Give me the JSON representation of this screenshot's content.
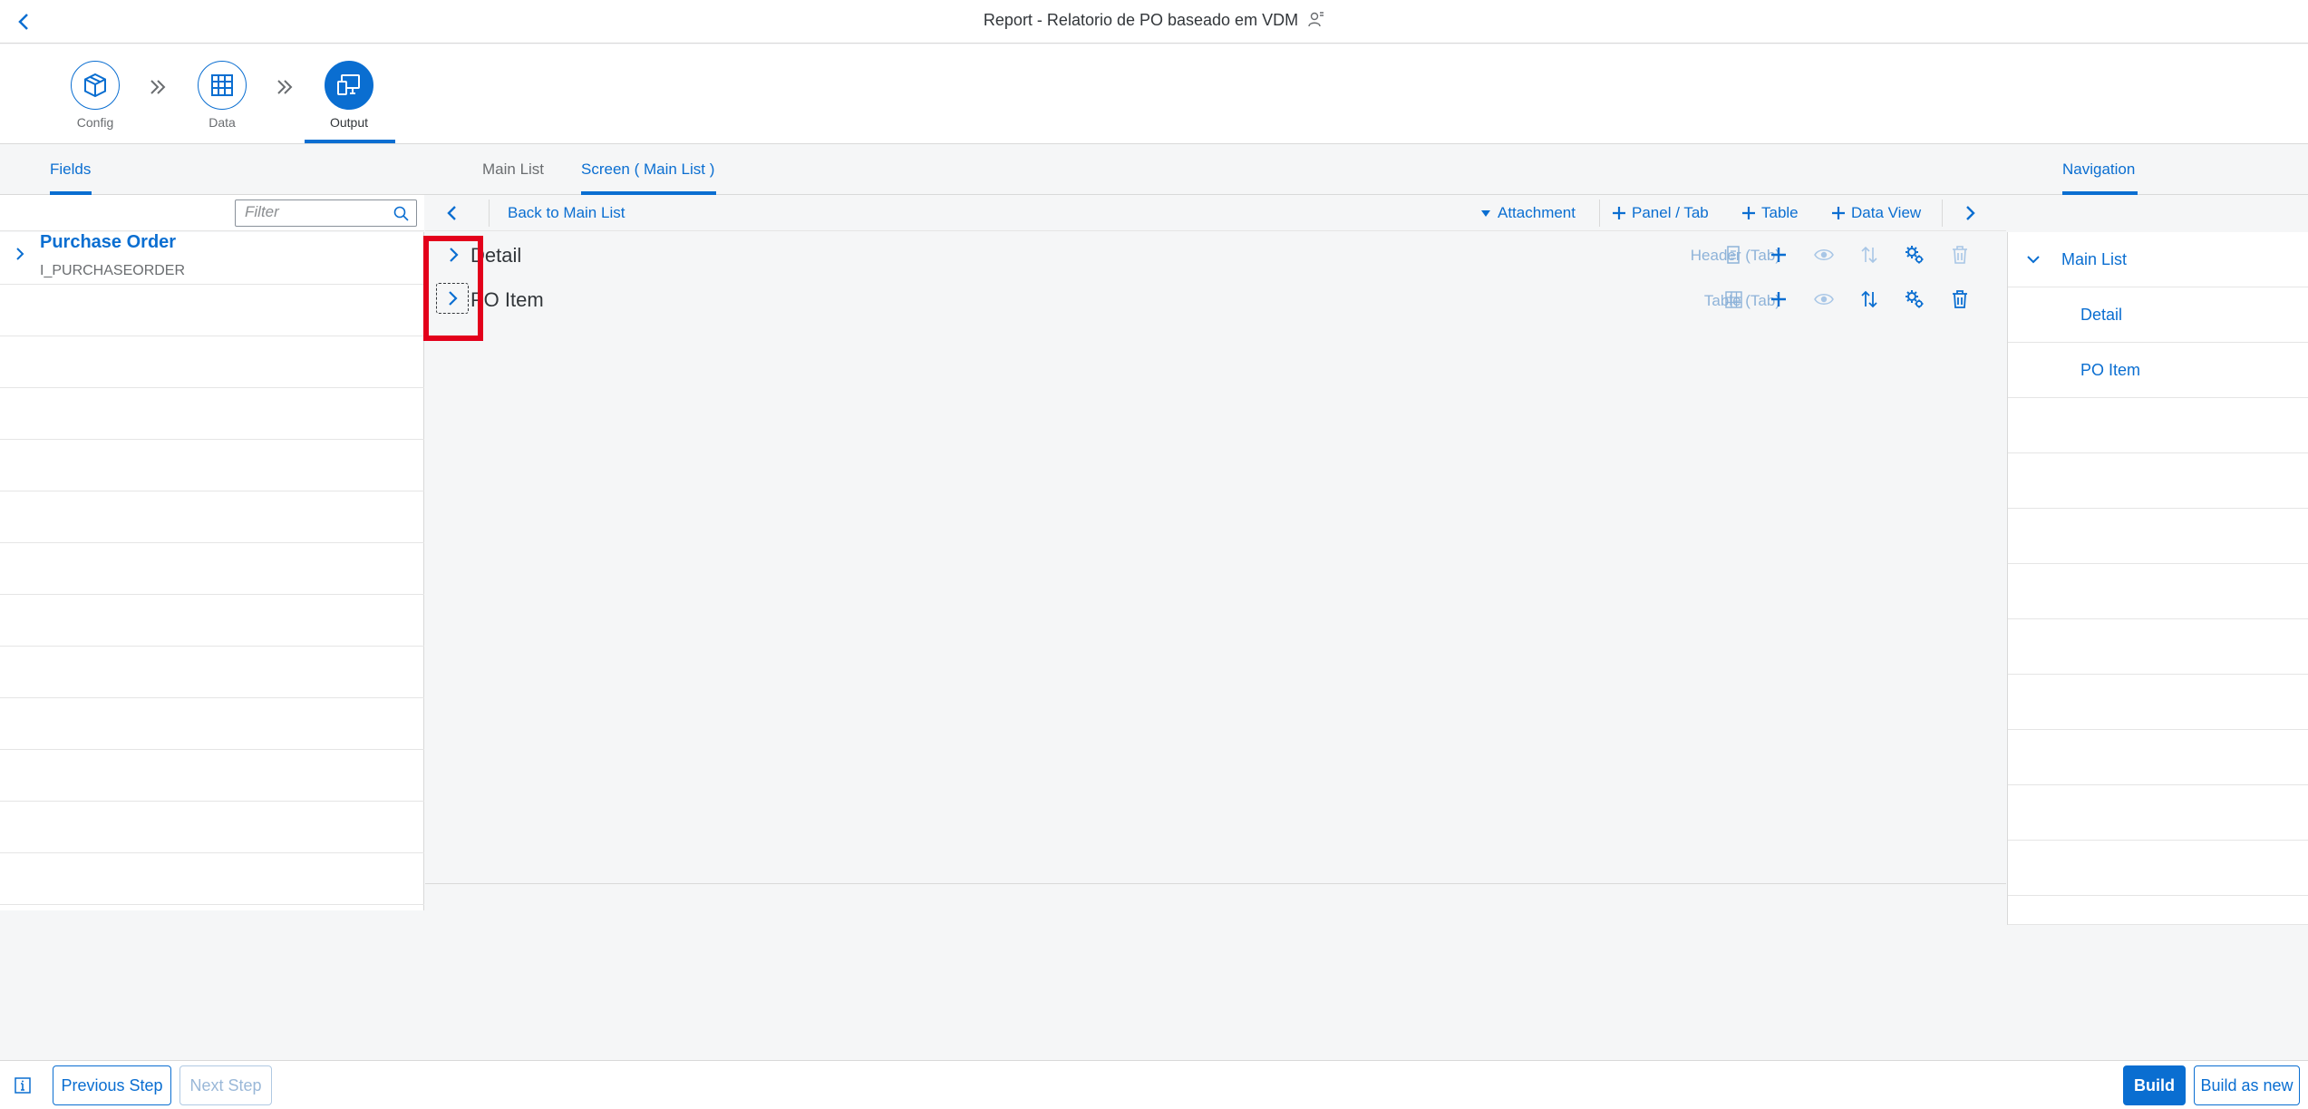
{
  "shell": {
    "title": "Report - Relatorio de PO baseado em VDM"
  },
  "wizard": {
    "steps": [
      {
        "label": "Config",
        "icon": "cube-box-icon"
      },
      {
        "label": "Data",
        "icon": "table-grid-icon"
      },
      {
        "label": "Output",
        "icon": "display-devices-icon",
        "active": true
      }
    ]
  },
  "tabs": {
    "fields": "Fields",
    "main_list": "Main List",
    "screen_main_list": "Screen ( Main List )",
    "navigation": "Navigation"
  },
  "filter": {
    "placeholder": "Filter"
  },
  "toolbar": {
    "back_to_main_list": "Back to Main List",
    "attachment": "Attachment",
    "panel_tab": "Panel / Tab",
    "table": "Table",
    "data_view": "Data View"
  },
  "fields_panel": {
    "entity_title": "Purchase Order",
    "entity_name": "I_PURCHASEORDER"
  },
  "screen_items": [
    {
      "label": "Detail",
      "type": "Header (Tab)",
      "type_icon": "document-icon"
    },
    {
      "label": "PO Item",
      "type": "Table (Tab)",
      "type_icon": "table-grid-icon"
    }
  ],
  "navigation": {
    "root": "Main List",
    "children": [
      "Detail",
      "PO Item"
    ]
  },
  "footer": {
    "previous_step": "Previous Step",
    "next_step": "Next Step",
    "build": "Build",
    "build_as_new": "Build as new"
  },
  "colors": {
    "accent": "#0a6ed1",
    "highlight": "#e3001b"
  }
}
